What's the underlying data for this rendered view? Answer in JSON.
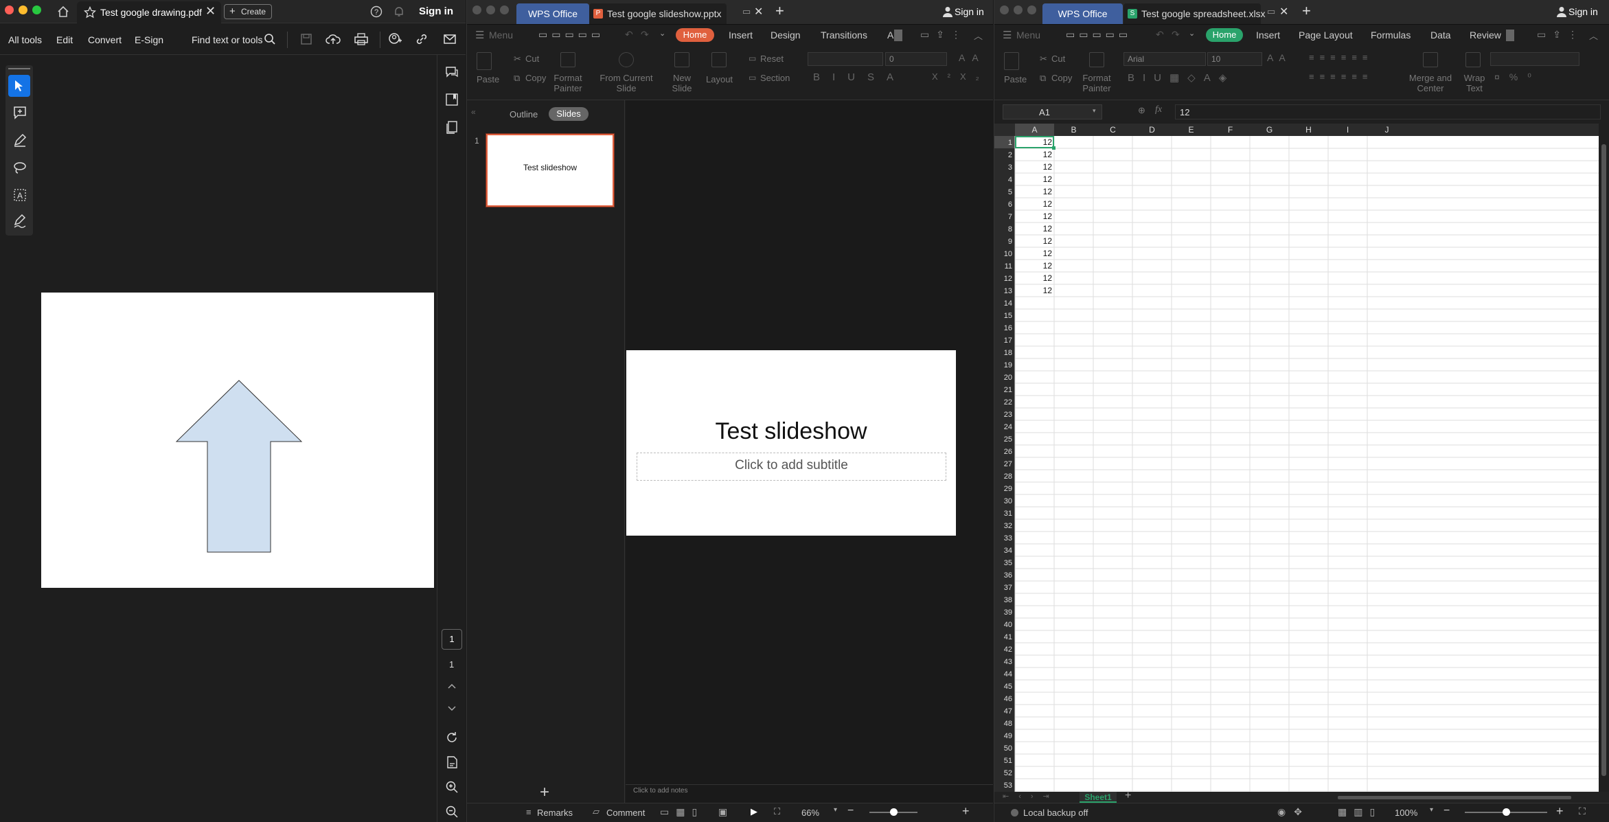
{
  "acrobat": {
    "tab_title": "Test google drawing.pdf",
    "create_label": "Create",
    "sign_in": "Sign in",
    "menu": [
      "All tools",
      "Edit",
      "Convert",
      "E-Sign"
    ],
    "find_label": "Find text or tools",
    "page_current": "1",
    "page_total": "1",
    "colors": {
      "shape_fill": "#cfdff0",
      "shape_stroke": "#333333",
      "select": "#1473e6"
    }
  },
  "slides": {
    "brand": "WPS Office",
    "tab_title": "Test google slideshow.pptx",
    "sign_in": "Sign in",
    "menu_label": "Menu",
    "menu": [
      "Home",
      "Insert",
      "Design",
      "Transitions",
      "A"
    ],
    "ribbon": {
      "paste": "Paste",
      "cut": "Cut",
      "copy": "Copy",
      "format_painter": "Format Painter",
      "from_current": "From Current Slide",
      "new_slide": "New Slide",
      "layout": "Layout",
      "reset": "Reset",
      "section": "Section",
      "font_size": "0"
    },
    "view_tabs": [
      "Outline",
      "Slides"
    ],
    "thumb_number": "1",
    "thumb_title": "Test slideshow",
    "slide_title": "Test slideshow",
    "slide_subtitle": "Click to add subtitle",
    "notes": "Click to add notes",
    "status": {
      "remarks": "Remarks",
      "comment": "Comment",
      "zoom": "66%"
    },
    "colors": {
      "accent": "#e0603e"
    }
  },
  "sheet": {
    "brand": "WPS Office",
    "tab_title": "Test google spreadsheet.xlsx",
    "sign_in": "Sign in",
    "menu_label": "Menu",
    "menu": [
      "Home",
      "Insert",
      "Page Layout",
      "Formulas",
      "Data",
      "Review"
    ],
    "ribbon": {
      "paste": "Paste",
      "cut": "Cut",
      "copy": "Copy",
      "format_painter": "Format Painter",
      "font": "Arial",
      "font_size": "10",
      "merge": "Merge and Center",
      "wrap": "Wrap Text"
    },
    "cell_ref": "A1",
    "fx": "fx",
    "formula": "12",
    "columns": [
      "A",
      "B",
      "C",
      "D",
      "E",
      "F",
      "G",
      "H",
      "I",
      "J"
    ],
    "row_count": 53,
    "col_a": [
      "12",
      "12",
      "12",
      "12",
      "12",
      "12",
      "12",
      "12",
      "12",
      "12",
      "12",
      "12",
      "12"
    ],
    "sheet_tab": "Sheet1",
    "status": {
      "backup": "Local backup off",
      "zoom": "100%"
    },
    "colors": {
      "accent": "#2aa36b",
      "brand": "#3f5f9e"
    }
  }
}
